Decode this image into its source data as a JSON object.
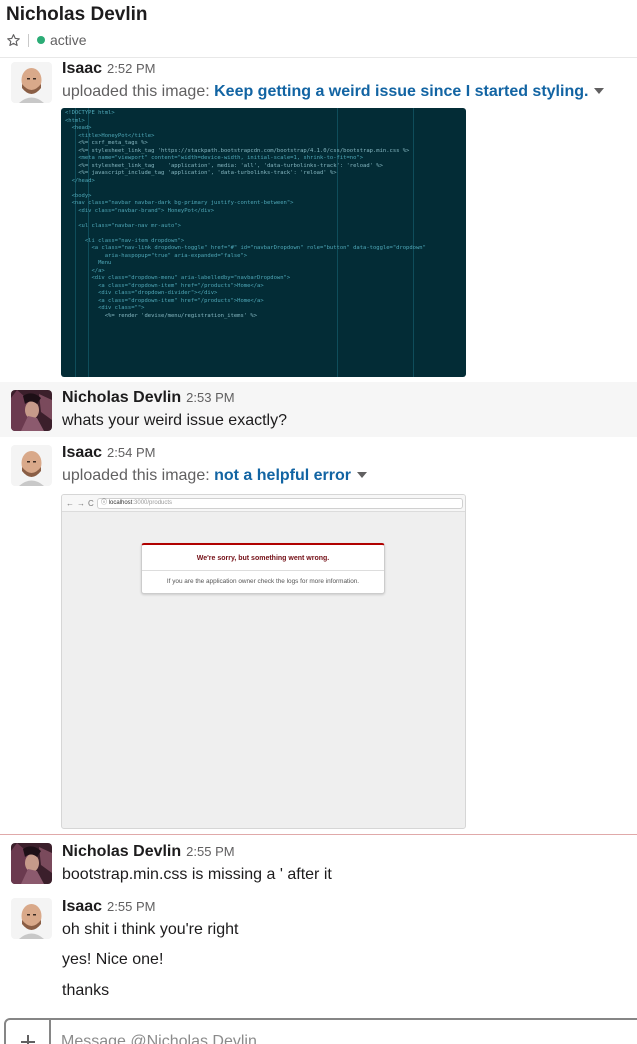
{
  "header": {
    "channel_name": "Nicholas Devlin",
    "status": "active",
    "status_color": "#2bac76"
  },
  "messages": [
    {
      "sender": "Isaac",
      "time": "2:52 PM",
      "upload_prefix": "uploaded this image:",
      "file_title": "Keep getting a weird issue since I started styling."
    },
    {
      "sender": "Nicholas Devlin",
      "time": "2:53 PM",
      "text": "whats your weird issue exactly?"
    },
    {
      "sender": "Isaac",
      "time": "2:54 PM",
      "upload_prefix": "uploaded this image:",
      "file_title": "not a helpful error"
    },
    {
      "sender": "Nicholas Devlin",
      "time": "2:55 PM",
      "text": "bootstrap.min.css is missing a ' after it"
    },
    {
      "sender": "Isaac",
      "time": "2:55 PM",
      "lines": [
        "oh shit i think you're right",
        "yes! Nice one!",
        "thanks"
      ]
    }
  ],
  "code_image": {
    "lines": [
      "<!DOCTYPE html>",
      "<html>",
      "  <head>",
      "    <title>HoneyPot</title>",
      "    <%= csrf_meta_tags %>",
      "    <%= stylesheet_link_tag 'https://stackpath.bootstrapcdn.com/bootstrap/4.1.0/css/bootstrap.min.css %>",
      "    <meta name=\"viewport\" content=\"width=device-width, initial-scale=1, shrink-to-fit=no\">",
      "    <%= stylesheet_link_tag    'application', media: 'all', 'data-turbolinks-track': 'reload' %>",
      "    <%= javascript_include_tag 'application', 'data-turbolinks-track': 'reload' %>",
      "  </head>",
      "",
      "  <body>",
      "  <nav class=\"navbar navbar-dark bg-primary justify-content-between\">",
      "    <div class=\"navbar-brand\"> HoneyPot</div>",
      "",
      "    <ul class=\"navbar-nav mr-auto\">",
      "",
      "      <li class=\"nav-item dropdown\">",
      "        <a class=\"nav-link dropdown-toggle\" href=\"#\" id=\"navbarDropdown\" role=\"button\" data-toggle=\"dropdown\"",
      "            aria-haspopup=\"true\" aria-expanded=\"false\">",
      "          Menu",
      "        </a>",
      "        <div class=\"dropdown-menu\" aria-labelledby=\"navbarDropdown\">",
      "          <a class=\"dropdown-item\" href=\"/products\">Home</a>",
      "          <div class=\"dropdown-divider\"></div>",
      "          <a class=\"dropdown-item\" href=\"/products\">Home</a>",
      "          <div class=\"\">",
      "            <%= render 'devise/menu/registration_items' %>"
    ]
  },
  "error_image": {
    "url_host": "localhost",
    "url_path": ":3000/products",
    "error_title": "We're sorry, but something went wrong.",
    "error_body": "If you are the application owner check the logs for more information."
  },
  "composer": {
    "placeholder": "Message @Nicholas Devlin"
  }
}
